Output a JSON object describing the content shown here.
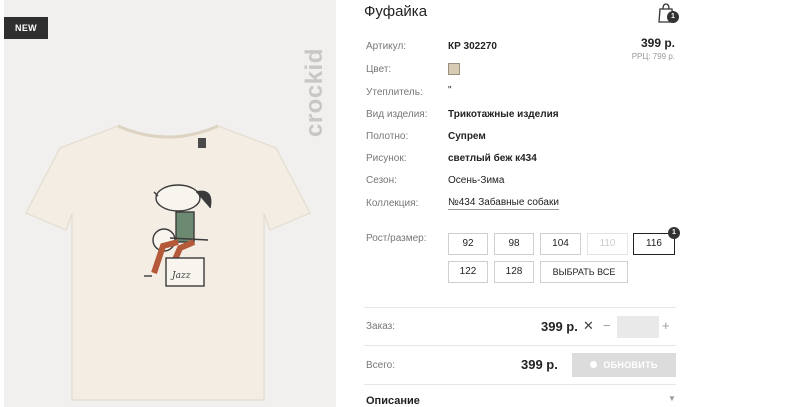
{
  "image": {
    "badge": "NEW",
    "brand": "crockid"
  },
  "product": {
    "title": "Фуфайка",
    "price": "399 р.",
    "rrp": "РРЦ: 799 р."
  },
  "cart": {
    "count": "1"
  },
  "attributes": {
    "article_label": "Артикул:",
    "article_value": "КР 302270",
    "color_label": "Цвет:",
    "color_swatch": "#d7cbb3",
    "insulation_label": "Утеплитель:",
    "insulation_value": "\"",
    "type_label": "Вид изделия:",
    "type_value": "Трикотажные изделия",
    "fabric_label": "Полотно:",
    "fabric_value": "Супрем",
    "print_label": "Рисунок:",
    "print_value": "светлый беж к434",
    "season_label": "Сезон:",
    "season_value": "Осень-Зима",
    "collection_label": "Коллекция:",
    "collection_value": "№434 Забавные собаки"
  },
  "sizes": {
    "label": "Рост/размер:",
    "row1": [
      "92",
      "98",
      "104",
      "110",
      "116"
    ],
    "row2": [
      "122",
      "128"
    ],
    "select_all": "ВЫБРАТЬ ВСЕ",
    "selected_count": "1"
  },
  "order": {
    "label": "Заказ:",
    "price": "399 р.",
    "quantity": "",
    "minus": "−",
    "plus": "+"
  },
  "total": {
    "label": "Всего:",
    "price": "399 р.",
    "update_label": "ОБНОВИТЬ"
  },
  "description": {
    "title": "Описание"
  }
}
